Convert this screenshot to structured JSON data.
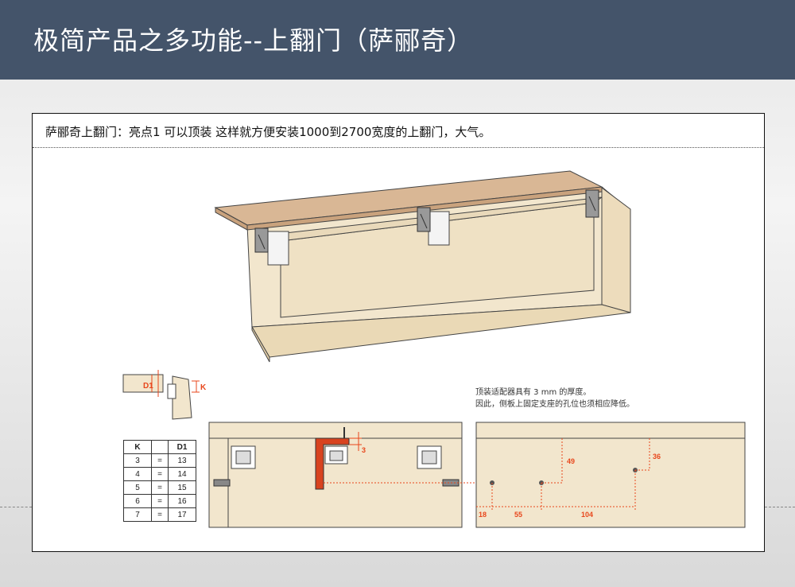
{
  "header": {
    "title": "极简产品之多功能--上翻门（萨郦奇）"
  },
  "caption": "萨郦奇上翻门：亮点1  可以顶装   这样就方便安装1000到2700宽度的上翻门，大气。",
  "note": {
    "line1": "顶装适配器具有 3 mm 的厚度。",
    "line2": "因此，侧板上固定支座的孔位也须相应降低。"
  },
  "labels": {
    "d1": "D1",
    "k": "K",
    "dim3": "3",
    "dim49": "49",
    "dim36": "36",
    "dim18": "18",
    "dim55": "55",
    "dim104": "104"
  },
  "table": {
    "headers": [
      "K",
      "",
      "D1"
    ],
    "rows": [
      [
        "3",
        "=",
        "13"
      ],
      [
        "4",
        "=",
        "14"
      ],
      [
        "5",
        "=",
        "15"
      ],
      [
        "6",
        "=",
        "16"
      ],
      [
        "7",
        "=",
        "17"
      ]
    ]
  },
  "colors": {
    "header_bg": "#44546a",
    "wood": "#f2e6cd",
    "top_panel": "#d9b795",
    "dimension": "#e8471c",
    "adapter": "#d8431f"
  }
}
